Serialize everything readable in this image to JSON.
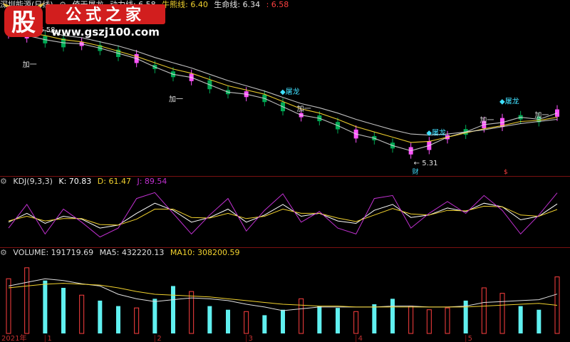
{
  "header": {
    "stock_name": "深圳能源(日线)",
    "indicator_name": "倚天屠龙",
    "items": [
      {
        "label": "动力线: 6.58",
        "color": "#e8e8e8"
      },
      {
        "label": "牛熊线: 6.40",
        "color": "#f2d22e"
      },
      {
        "label": "生命线: 6.34",
        "color": "#e8e8e8"
      },
      {
        "label": ": 6.58",
        "color": "#ff4040"
      }
    ]
  },
  "kdj_header": {
    "name": "KDJ(9,3,3)",
    "k": "K: 70.83",
    "d": "D: 61.47",
    "j": "J: 89.54"
  },
  "vol_header": {
    "name": "VOLUME: 191719.69",
    "ma5": "MA5: 432220.13",
    "ma10": "MA10: 308200.59"
  },
  "annotations": {
    "high_label": "6.58",
    "low_label": "5.31",
    "add_label": "加一",
    "dragon_label": "屠龙",
    "cai_label": "财",
    "cai2_label": "$"
  },
  "x_axis": {
    "year_label": "2021年",
    "months": [
      "1",
      "2",
      "3",
      "4",
      "5"
    ]
  },
  "logo": {
    "badge": "股",
    "text": "公式之家",
    "url": "www.gszj100.com"
  },
  "colors": {
    "up": "#ff55ff",
    "down": "#00aa55",
    "line_white": "#e0e0e0",
    "line_yellow": "#f2d22e",
    "kdj_k": "#ffffff",
    "kdj_d": "#f2d22e",
    "kdj_j": "#c030d0",
    "vol_up": "#ff4040",
    "vol_down": "#60f0f0",
    "grid": "#7a1010"
  },
  "chart_data": [
    {
      "type": "candlestick",
      "title": "深圳能源(日线)",
      "ylim": [
        5.2,
        6.75
      ],
      "high_mark": 6.58,
      "low_mark": 5.31,
      "series": [
        {
          "name": "动力线",
          "values": [
            6.55,
            6.52,
            6.48,
            6.45,
            6.44,
            6.4,
            6.35,
            6.3,
            6.22,
            6.15,
            6.12,
            6.05,
            5.98,
            5.96,
            5.92,
            5.84,
            5.76,
            5.73,
            5.66,
            5.58,
            5.54,
            5.47,
            5.42,
            5.47,
            5.55,
            5.6,
            5.67,
            5.69,
            5.74,
            5.72,
            5.78
          ]
        },
        {
          "name": "牛熊线",
          "values": [
            6.6,
            6.55,
            6.52,
            6.48,
            6.46,
            6.42,
            6.37,
            6.32,
            6.26,
            6.2,
            6.16,
            6.1,
            6.04,
            6.0,
            5.96,
            5.89,
            5.82,
            5.78,
            5.72,
            5.65,
            5.6,
            5.55,
            5.5,
            5.51,
            5.55,
            5.59,
            5.63,
            5.66,
            5.7,
            5.71,
            5.74
          ]
        },
        {
          "name": "生命线",
          "values": [
            6.65,
            6.6,
            6.57,
            6.52,
            6.5,
            6.46,
            6.42,
            6.37,
            6.31,
            6.26,
            6.21,
            6.15,
            6.09,
            6.04,
            5.99,
            5.93,
            5.87,
            5.83,
            5.78,
            5.72,
            5.67,
            5.62,
            5.58,
            5.57,
            5.58,
            5.6,
            5.62,
            5.65,
            5.68,
            5.7,
            5.72
          ]
        }
      ]
    },
    {
      "type": "line",
      "title": "KDJ(9,3,3)",
      "ylim": [
        0,
        100
      ],
      "series": [
        {
          "name": "K",
          "values": [
            40,
            55,
            38,
            50,
            45,
            30,
            35,
            55,
            72,
            60,
            40,
            48,
            62,
            40,
            52,
            70,
            50,
            55,
            42,
            38,
            60,
            70,
            48,
            52,
            64,
            58,
            72,
            66,
            44,
            50,
            70.83
          ]
        },
        {
          "name": "D",
          "values": [
            42,
            50,
            42,
            46,
            46,
            36,
            35,
            45,
            62,
            62,
            48,
            47,
            55,
            46,
            50,
            62,
            55,
            55,
            47,
            41,
            52,
            63,
            54,
            52,
            60,
            59,
            67,
            66,
            52,
            50,
            61.47
          ]
        },
        {
          "name": "J",
          "values": [
            30,
            70,
            20,
            62,
            40,
            15,
            30,
            80,
            90,
            55,
            20,
            52,
            80,
            25,
            60,
            88,
            40,
            58,
            30,
            20,
            80,
            85,
            30,
            55,
            75,
            55,
            85,
            60,
            20,
            52,
            89.54
          ]
        }
      ]
    },
    {
      "type": "bar",
      "title": "VOLUME",
      "ylim": [
        0,
        1000000
      ],
      "values": [
        600,
        720,
        580,
        500,
        420,
        360,
        300,
        280,
        380,
        520,
        460,
        300,
        260,
        240,
        200,
        260,
        380,
        300,
        280,
        240,
        320,
        380,
        300,
        260,
        280,
        360,
        500,
        440,
        300,
        260,
        620
      ],
      "value_units": "thousands (approx.)",
      "series": [
        {
          "name": "MA5",
          "values": [
            520,
            560,
            600,
            580,
            545,
            520,
            430,
            380,
            350,
            370,
            390,
            380,
            360,
            320,
            290,
            250,
            270,
            290,
            290,
            290,
            290,
            300,
            300,
            290,
            290,
            300,
            340,
            350,
            360,
            370,
            432.22
          ]
        },
        {
          "name": "MA10",
          "values": [
            500,
            520,
            540,
            550,
            540,
            530,
            500,
            460,
            430,
            420,
            410,
            400,
            380,
            360,
            340,
            320,
            310,
            300,
            300,
            290,
            290,
            290,
            290,
            290,
            290,
            290,
            300,
            310,
            320,
            330,
            308.2
          ]
        }
      ]
    }
  ]
}
